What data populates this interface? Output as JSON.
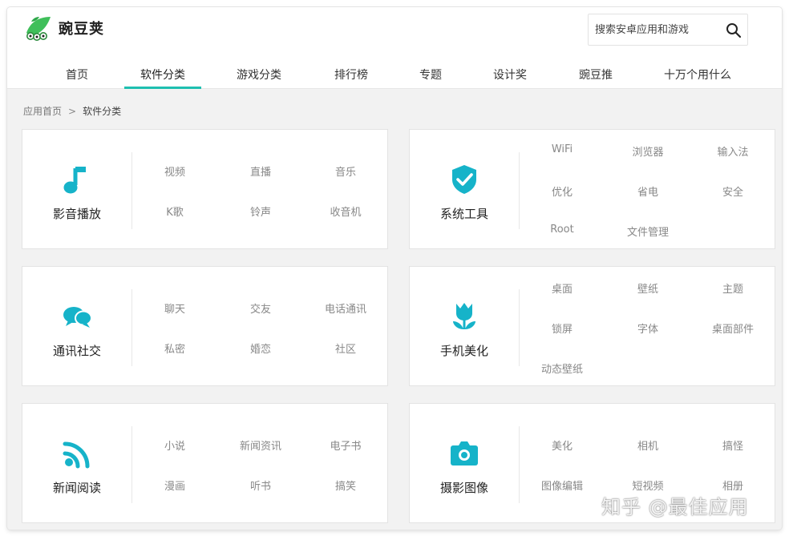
{
  "app": {
    "name": "豌豆荚",
    "brand_color": "#1ebfb0",
    "icon_color": "#16b3c9"
  },
  "search": {
    "placeholder": "搜索安卓应用和游戏",
    "icon": "search-icon"
  },
  "nav": {
    "items": [
      {
        "label": "首页",
        "active": false
      },
      {
        "label": "软件分类",
        "active": true
      },
      {
        "label": "游戏分类",
        "active": false
      },
      {
        "label": "排行榜",
        "active": false
      },
      {
        "label": "专题",
        "active": false
      },
      {
        "label": "设计奖",
        "active": false
      },
      {
        "label": "豌豆推",
        "active": false
      },
      {
        "label": "十万个用什么",
        "active": false
      }
    ]
  },
  "breadcrumb": {
    "home": "应用首页",
    "separator": ">",
    "current": "软件分类"
  },
  "categories": [
    {
      "name": "影音播放",
      "icon": "music-note-icon",
      "subs": [
        "视频",
        "直播",
        "音乐",
        "K歌",
        "铃声",
        "收音机"
      ]
    },
    {
      "name": "系统工具",
      "icon": "shield-check-icon",
      "subs": [
        "WiFi",
        "浏览器",
        "输入法",
        "优化",
        "省电",
        "安全",
        "Root",
        "文件管理"
      ]
    },
    {
      "name": "通讯社交",
      "icon": "chat-bubbles-icon",
      "subs": [
        "聊天",
        "交友",
        "电话通讯",
        "私密",
        "婚恋",
        "社区"
      ]
    },
    {
      "name": "手机美化",
      "icon": "tulip-icon",
      "subs": [
        "桌面",
        "壁纸",
        "主题",
        "锁屏",
        "字体",
        "桌面部件",
        "动态壁纸"
      ]
    },
    {
      "name": "新闻阅读",
      "icon": "rss-feed-icon",
      "subs": [
        "小说",
        "新闻资讯",
        "电子书",
        "漫画",
        "听书",
        "搞笑"
      ]
    },
    {
      "name": "摄影图像",
      "icon": "camera-icon",
      "subs": [
        "美化",
        "相机",
        "搞怪",
        "图像编辑",
        "短视频",
        "相册"
      ]
    }
  ],
  "watermark": "知乎 @最佳应用"
}
